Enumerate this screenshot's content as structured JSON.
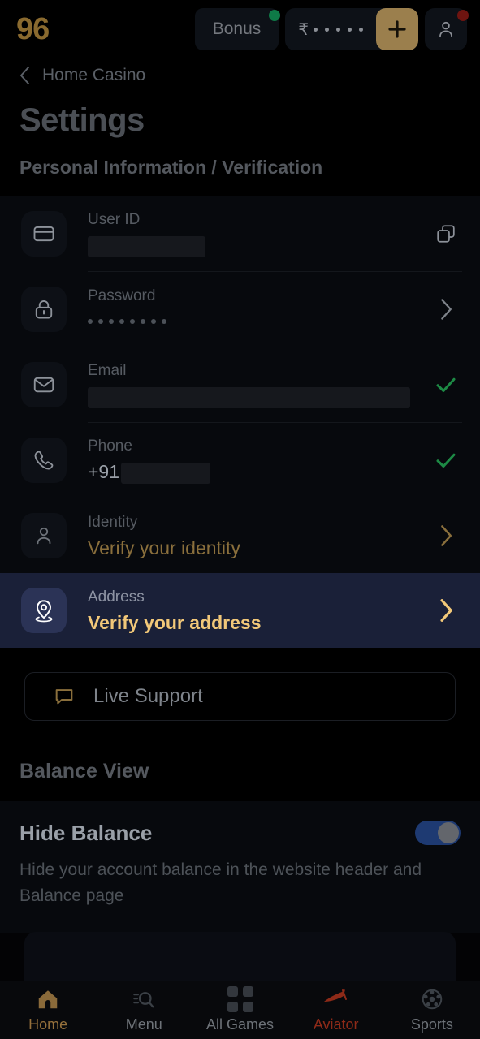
{
  "topbar": {
    "logo": "96",
    "bonus_label": "Bonus",
    "currency_symbol": "₹",
    "balance_masked_dots": 5,
    "plus_icon": "plus-icon",
    "user_icon": "user-icon",
    "bonus_badge_color": "#0e7a47",
    "user_badge_color": "#6e1410",
    "accent_gold": "#9b7f4d"
  },
  "breadcrumb": {
    "back_icon": "chevron-left-icon",
    "text": "Home Casino"
  },
  "page": {
    "title": "Settings",
    "subtitle": "Personal Information / Verification"
  },
  "settings_rows": [
    {
      "icon": "card-icon",
      "label": "User ID",
      "value": "",
      "value_redacted": true,
      "redact_width": 145,
      "trailing": "copy-icon",
      "highlighted": false
    },
    {
      "icon": "lock-icon",
      "label": "Password",
      "value": "",
      "password_dots": 8,
      "trailing": "chevron-right-icon",
      "highlighted": false
    },
    {
      "icon": "mail-icon",
      "label": "Email",
      "value": "",
      "value_redacted": true,
      "redact_width": 397,
      "trailing": "check-icon",
      "highlighted": false
    },
    {
      "icon": "phone-icon",
      "label": "Phone",
      "value": "+91",
      "value_redacted": true,
      "redact_width": 110,
      "trailing": "check-icon",
      "highlighted": false
    },
    {
      "icon": "person-icon",
      "label": "Identity",
      "value": "Verify your identity",
      "value_style": "gold",
      "trailing": "chevron-right-gold-icon",
      "highlighted": false
    },
    {
      "icon": "location-pin-icon",
      "label": "Address",
      "value": "Verify your address",
      "trailing": "chevron-right-bright-icon",
      "highlighted": true
    }
  ],
  "support": {
    "icon": "chat-bubble-icon",
    "label": "Live Support"
  },
  "balance_view": {
    "section_title": "Balance View",
    "hide_balance_title": "Hide Balance",
    "hide_balance_desc": "Hide your account balance in the website header and Balance page",
    "toggle_on": true,
    "toggle_on_color": "#1e3a72"
  },
  "partial_card": {
    "text": ""
  },
  "bottom_nav": [
    {
      "icon": "home-icon",
      "label": "Home",
      "active": true
    },
    {
      "icon": "menu-search-icon",
      "label": "Menu",
      "active": false
    },
    {
      "icon": "grid-icon",
      "label": "All Games",
      "active": false
    },
    {
      "icon": "aviator-plane-icon",
      "label": "Aviator",
      "active": false
    },
    {
      "icon": "soccer-ball-icon",
      "label": "Sports",
      "active": false
    }
  ],
  "colors": {
    "background": "#030305",
    "panel": "#07090d",
    "accent_gold": "#8a6a2f",
    "highlight_row": "#1a2038",
    "verified_green": "#1d8a45",
    "aviator_red": "#8e2a18"
  }
}
